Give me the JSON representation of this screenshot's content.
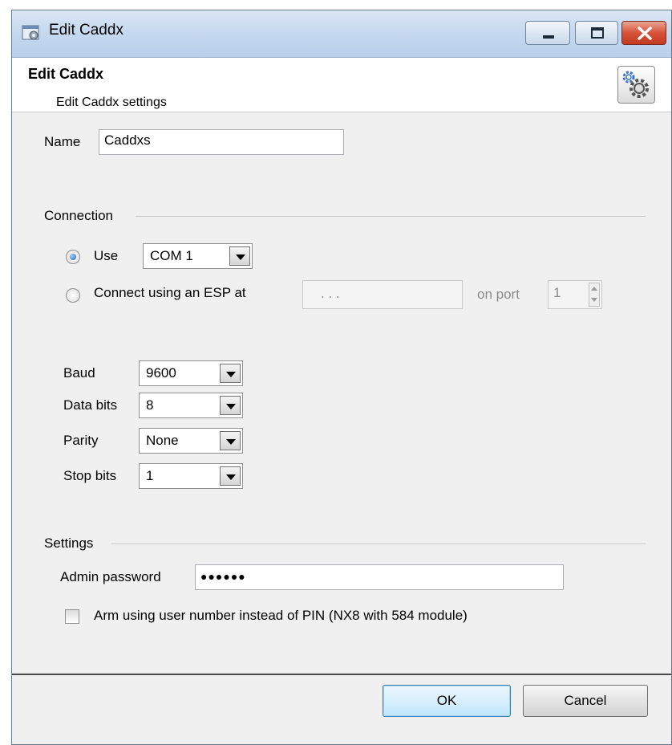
{
  "window": {
    "title": "Edit Caddx"
  },
  "header": {
    "title": "Edit Caddx",
    "subtitle": "Edit Caddx settings"
  },
  "name_field": {
    "label": "Name",
    "value": "Caddxs"
  },
  "connection": {
    "group_label": "Connection",
    "use_label": "Use",
    "com_port": "COM 1",
    "esp_label": "Connect using an ESP at",
    "esp_address": ".   .   .",
    "port_label": "on port",
    "port_value": "1"
  },
  "serial": {
    "baud_label": "Baud",
    "baud_value": "9600",
    "databits_label": "Data bits",
    "databits_value": "8",
    "parity_label": "Parity",
    "parity_value": "None",
    "stopbits_label": "Stop bits",
    "stopbits_value": "1"
  },
  "settings": {
    "group_label": "Settings",
    "admin_password_label": "Admin password",
    "admin_password_value": "●●●●●●",
    "arm_checkbox_label": "Arm using user number instead of PIN (NX8 with 584 module)"
  },
  "buttons": {
    "ok": "OK",
    "cancel": "Cancel"
  }
}
